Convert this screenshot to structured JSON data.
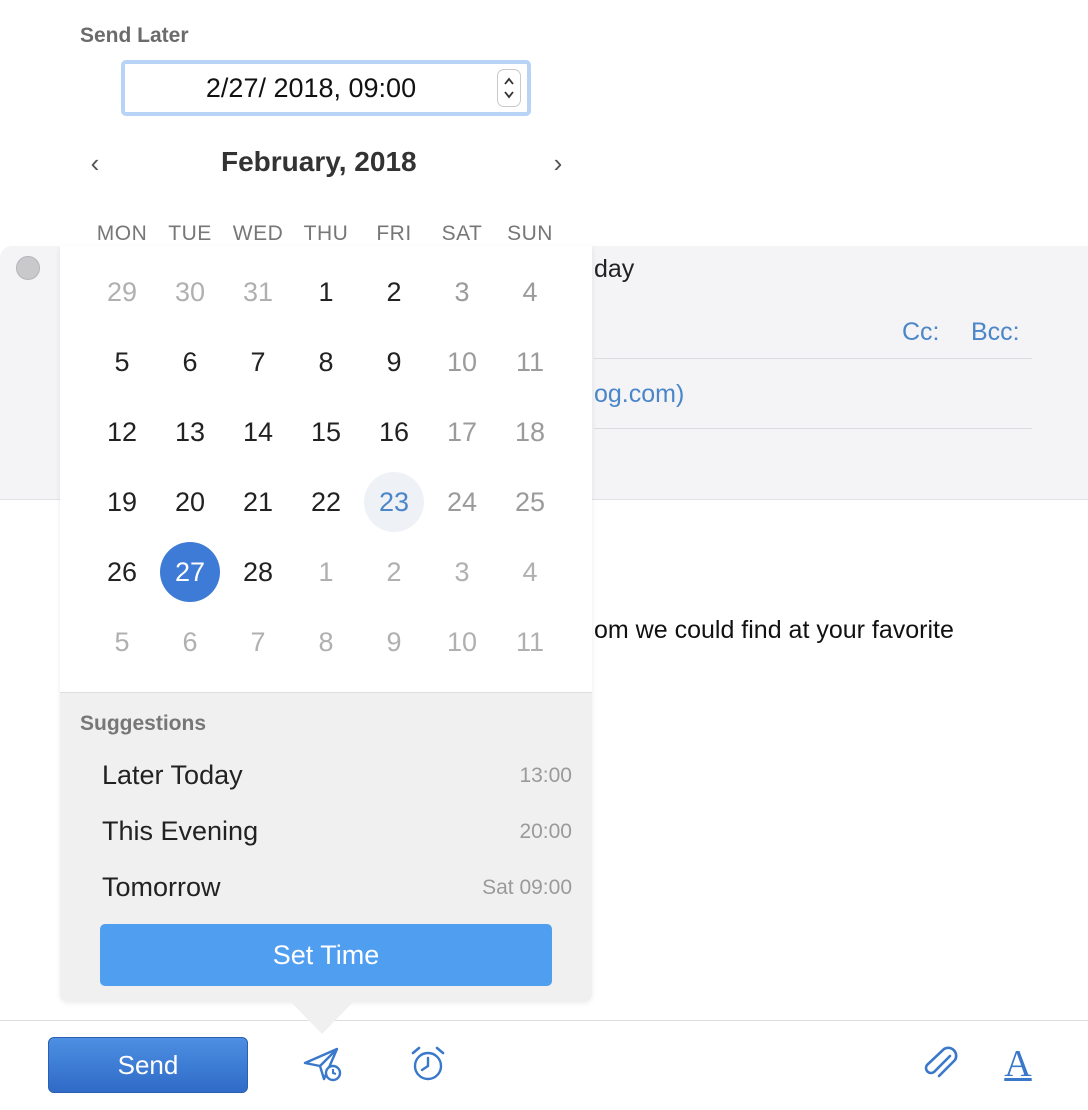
{
  "compose": {
    "subject_fragment": "day",
    "cc_label": "Cc:",
    "bcc_label": "Bcc:",
    "from_fragment": "og.com)",
    "body_fragment": "om we could find at your favorite"
  },
  "toolbar": {
    "send_label": "Send",
    "font_glyph": "A"
  },
  "send_later": {
    "label": "Send Later",
    "datetime_value": "2/27/ 2018, 09:00",
    "month_title": "February, 2018",
    "prev_glyph": "‹",
    "next_glyph": "›",
    "weekdays": [
      "MON",
      "TUE",
      "WED",
      "THU",
      "FRI",
      "SAT",
      "SUN"
    ],
    "weeks": [
      [
        {
          "d": "29",
          "s": "oth"
        },
        {
          "d": "30",
          "s": "oth"
        },
        {
          "d": "31",
          "s": "oth"
        },
        {
          "d": "1",
          "s": "cur"
        },
        {
          "d": "2",
          "s": "cur"
        },
        {
          "d": "3",
          "s": "wk"
        },
        {
          "d": "4",
          "s": "wk"
        }
      ],
      [
        {
          "d": "5",
          "s": "cur"
        },
        {
          "d": "6",
          "s": "cur"
        },
        {
          "d": "7",
          "s": "cur"
        },
        {
          "d": "8",
          "s": "cur"
        },
        {
          "d": "9",
          "s": "cur"
        },
        {
          "d": "10",
          "s": "wk"
        },
        {
          "d": "11",
          "s": "wk"
        }
      ],
      [
        {
          "d": "12",
          "s": "cur"
        },
        {
          "d": "13",
          "s": "cur"
        },
        {
          "d": "14",
          "s": "cur"
        },
        {
          "d": "15",
          "s": "cur"
        },
        {
          "d": "16",
          "s": "cur"
        },
        {
          "d": "17",
          "s": "wk"
        },
        {
          "d": "18",
          "s": "wk"
        }
      ],
      [
        {
          "d": "19",
          "s": "cur"
        },
        {
          "d": "20",
          "s": "cur"
        },
        {
          "d": "21",
          "s": "cur"
        },
        {
          "d": "22",
          "s": "cur"
        },
        {
          "d": "23",
          "s": "today"
        },
        {
          "d": "24",
          "s": "wk"
        },
        {
          "d": "25",
          "s": "wk"
        }
      ],
      [
        {
          "d": "26",
          "s": "cur"
        },
        {
          "d": "27",
          "s": "sel"
        },
        {
          "d": "28",
          "s": "cur"
        },
        {
          "d": "1",
          "s": "oth"
        },
        {
          "d": "2",
          "s": "oth"
        },
        {
          "d": "3",
          "s": "oth"
        },
        {
          "d": "4",
          "s": "oth"
        }
      ],
      [
        {
          "d": "5",
          "s": "oth"
        },
        {
          "d": "6",
          "s": "oth"
        },
        {
          "d": "7",
          "s": "oth"
        },
        {
          "d": "8",
          "s": "oth"
        },
        {
          "d": "9",
          "s": "oth"
        },
        {
          "d": "10",
          "s": "oth"
        },
        {
          "d": "11",
          "s": "oth"
        }
      ]
    ],
    "suggestions_title": "Suggestions",
    "suggestions": [
      {
        "label": "Later Today",
        "time": "13:00"
      },
      {
        "label": "This Evening",
        "time": "20:00"
      },
      {
        "label": "Tomorrow",
        "time": "Sat 09:00"
      }
    ],
    "set_time_label": "Set Time"
  },
  "colors": {
    "accent": "#3e7bd6",
    "button_blue": "#4f9ef0",
    "link_blue": "#4a86c8"
  }
}
